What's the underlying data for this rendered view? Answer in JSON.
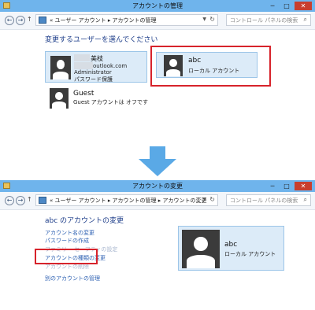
{
  "window1": {
    "title": "アカウントの管理",
    "window_controls": {
      "minimize": "─",
      "maximize": "□",
      "close": "✕"
    },
    "address": {
      "crumbs": "« ユーザー アカウント  ▸  アカウントの管理"
    },
    "search": {
      "placeholder": "コントロール パネルの検索"
    },
    "heading": "変更するユーザーを選んでください",
    "accounts": [
      {
        "name_visible": "美枝",
        "email_visible": "outlook.com",
        "role": "Administrator",
        "status": "パスワード保護"
      },
      {
        "name": "abc",
        "type": "ローカル アカウント"
      },
      {
        "name": "Guest",
        "status": "Guest アカウントは オフです"
      }
    ]
  },
  "window2": {
    "title": "アカウントの変更",
    "window_controls": {
      "minimize": "─",
      "maximize": "□",
      "close": "✕"
    },
    "address": {
      "crumbs": "« ユーザー アカウント  ▸  アカウントの管理  ▸  アカウントの変更"
    },
    "search": {
      "placeholder": "コントロール パネルの検索"
    },
    "heading": "abc のアカウントの変更",
    "links": {
      "rename": "アカウント名の変更",
      "password": "パスワードの作成",
      "obscured": "ファミリー セーフティの設定",
      "change_type": "アカウントの種類の変更",
      "delete": "アカウントの削除",
      "other": "別のアカウントの管理"
    },
    "account": {
      "name": "abc",
      "type": "ローカル アカウント"
    }
  },
  "colors": {
    "titlebar": "#6fb4ec",
    "link": "#2f62b3",
    "highlight": "#d7232b",
    "arrow": "#5aa9e6"
  }
}
